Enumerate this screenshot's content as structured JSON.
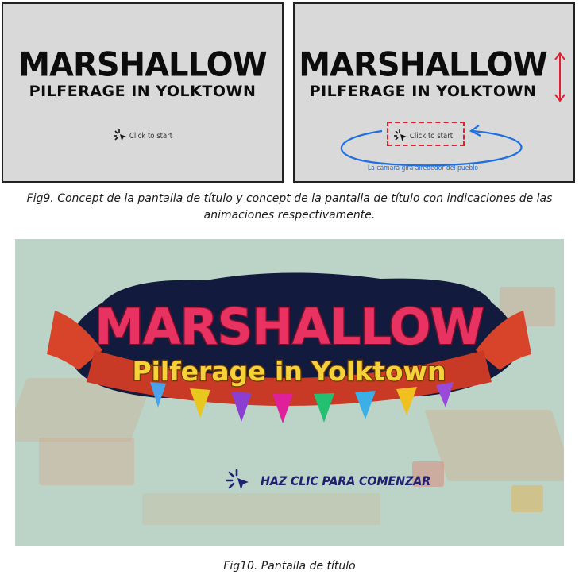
{
  "concept_left": {
    "title": "MARSHALLOW",
    "subtitle": "PILFERAGE IN YOLKTOWN",
    "start_label": "Click to start"
  },
  "concept_right": {
    "title": "MARSHALLOW",
    "subtitle": "PILFERAGE IN YOLKTOWN",
    "start_label": "Click to start",
    "camera_note": "La cámara gira alrededor del pueblo"
  },
  "fig9_caption": "Fig9. Concept de la pantalla de título y concept de la pantalla de título con indicaciones de las animaciones respectivamente.",
  "screen": {
    "logo_title": "MARSHALLOW",
    "logo_subtitle": "Pilferage in Yolktown",
    "start_label": "HAZ CLIC PARA COMENZAR",
    "flag_colors": [
      "#4aa3e8",
      "#e8c81e",
      "#8a3fd0",
      "#e0209a",
      "#22c070",
      "#3ab0e6",
      "#f0c020",
      "#9a4ad8"
    ]
  },
  "fig10_caption": "Fig10. Pantalla de título",
  "colors": {
    "concept_bg": "#d9d9d9",
    "annotation_red": "#e02030",
    "annotation_blue": "#1e6fe0",
    "screen_bg": "#bcd4c8",
    "logo_pink": "#e83262",
    "logo_yellow": "#f6d23a",
    "logo_navy": "#121a3e",
    "ribbon_red": "#d8442a"
  }
}
